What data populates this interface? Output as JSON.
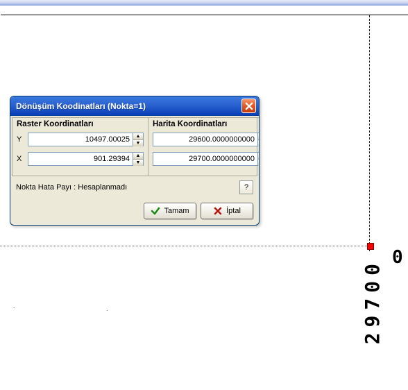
{
  "annotations": {
    "vline_text": "29700",
    "char0": "0"
  },
  "dialog": {
    "title": "Dönüşüm Koodinatları (Nokta=1)",
    "raster": {
      "header": "Raster Koordinatları",
      "y_label": "Y",
      "x_label": "X",
      "y_value": "10497.00025",
      "x_value": "901.29394"
    },
    "harita": {
      "header": "Harita Koordinatları",
      "y_value": "29600.0000000000",
      "x_value": "29700.0000000000"
    },
    "error_label": "Nokta Hata Payı : Hesaplanmadı",
    "help_label": "?",
    "ok_label": "Tamam",
    "cancel_label": "İptal"
  }
}
